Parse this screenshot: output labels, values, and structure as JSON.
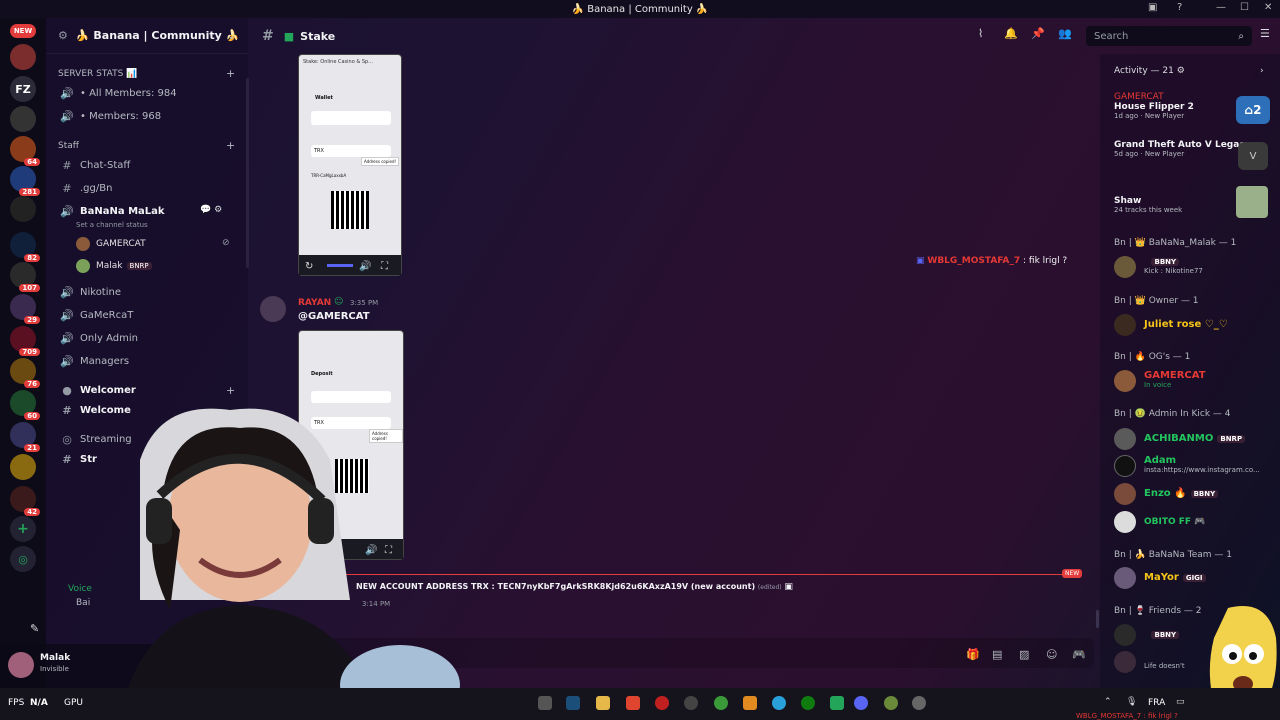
{
  "window": {
    "title": "🍌 Banana | Community 🍌"
  },
  "server": {
    "name": "🍌 Banana | Community 🍌"
  },
  "rail": {
    "new_badge": "NEW",
    "items": [
      {
        "label": "FZ"
      },
      {
        "label": "",
        "badge": "64"
      },
      {
        "label": "",
        "badge": "281"
      },
      {
        "label": "",
        "badge": "82"
      },
      {
        "label": "",
        "badge": "107"
      },
      {
        "label": "",
        "badge": "29"
      },
      {
        "label": "",
        "badge": "709"
      },
      {
        "label": "",
        "badge": "76"
      },
      {
        "label": "",
        "badge": "60"
      },
      {
        "label": "",
        "badge": "21"
      },
      {
        "label": "",
        "badge": "42"
      }
    ]
  },
  "sidebar": {
    "server_stats": "SERVER STATS 📊",
    "all_members": "• All Members: 984",
    "members": "• Members: 968",
    "staff_category": "Staff",
    "channels_staff": [
      {
        "name": "Chat-Staff",
        "icon": "#"
      },
      {
        "name": ".gg/Bn",
        "icon": "#"
      },
      {
        "name": "BaNaNa MaLak",
        "icon": "🔊"
      }
    ],
    "channel_status": "Set a channel status",
    "voice_users": [
      {
        "name": "GAMERCAT"
      },
      {
        "name": "Malak",
        "tag": "BNRP"
      }
    ],
    "channels_more": [
      {
        "name": "Nikotine"
      },
      {
        "name": "GaMeRcaT"
      },
      {
        "name": "Only Admin"
      },
      {
        "name": "Managers"
      }
    ],
    "welcomer_category": "Welcomer",
    "welcome_channel": "Welcome",
    "streaming_category": "Streaming",
    "str_channel": "Str",
    "voice_label": "Voice",
    "bai_label": "Bai"
  },
  "user": {
    "name": "Malak",
    "status": "Invisible"
  },
  "chat": {
    "channel": "Stake",
    "search_placeholder": "Search",
    "right_message": {
      "author": "WBLG_MOSTAFA_7",
      "text": ": fik lrigl ?"
    },
    "message": {
      "author": "RAYAN",
      "time": "3:35 PM",
      "mention": "@GAMERCAT"
    },
    "phone1": {
      "title": "Stake: Online Casino & Sp...",
      "wallet": "Wallet",
      "network": "TRX",
      "copied": "Address copied!",
      "address": "TRR-CaMgLaxxbA"
    },
    "phone2": {
      "deposit": "Deposit",
      "network": "TRX",
      "copied": "Address copied!"
    },
    "new_divider": "NEW",
    "bottom_message": "NEW ACCOUNT ADDRESS TRX : TECN7nyKbF7gArkSRK8Kjd62u6KAxzA19V  (new account)",
    "edited": "(edited)",
    "bottom_time": "3:14 PM"
  },
  "activity": {
    "header": "Activity — 21",
    "items": [
      {
        "user": "GAMERCAT",
        "game": "House Flipper 2",
        "meta": "1d ago  ·  New Player"
      },
      {
        "user": "",
        "game": "Grand Theft Auto V Legacy",
        "meta": "5d ago  ·  New Player"
      },
      {
        "user": "",
        "game": "Shaw",
        "meta": "24 tracks this week"
      }
    ]
  },
  "members": {
    "groups": [
      {
        "title": "Bn | 👑 BaNaNa_Malak — 1",
        "rows": [
          {
            "name": "",
            "tag": "BBNY",
            "sub": "Kick : Nikotine77",
            "color": "#3b82f6"
          }
        ]
      },
      {
        "title": "Bn | 👑 Owner — 1",
        "rows": [
          {
            "name": "Juliet rose ♡_♡",
            "sub": "",
            "color": "#f5c518"
          }
        ]
      },
      {
        "title": "Bn | 🔥 OG's — 1",
        "rows": [
          {
            "name": "GAMERCAT",
            "sub": "In voice",
            "color": "#e53935"
          }
        ]
      },
      {
        "title": "Bn | 🤢 Admin In Kick — 4",
        "rows": [
          {
            "name": "ACHIBANMO",
            "tag": "BNRP",
            "sub": "",
            "color": "#22c55e"
          },
          {
            "name": "Adam",
            "sub": "insta:https://www.instagram.co...",
            "color": "#22c55e"
          },
          {
            "name": "Enzo 🔥",
            "tag": "BBNY",
            "sub": "",
            "color": "#22c55e"
          },
          {
            "name": "OBITO FF 🎮",
            "sub": "",
            "color": "#22c55e"
          }
        ]
      },
      {
        "title": "Bn | 🍌 BaNaNa Team — 1",
        "rows": [
          {
            "name": "MaYor",
            "tag": "GIGI",
            "sub": "",
            "color": "#f5c518"
          }
        ]
      },
      {
        "title": "Bn | 🍷 Friends — 2",
        "rows": [
          {
            "name": "",
            "tag": "BBNY",
            "sub": "",
            "color": "#3b82f6"
          },
          {
            "name": "",
            "sub": "Life doesn't",
            "color": "#3b82f6"
          }
        ]
      }
    ]
  },
  "taskbar": {
    "fps": "FPS",
    "fps_val": "N/A",
    "gpu": "GPU",
    "lang": "FRA",
    "tray_text": "WBLG_MOSTAFA_7 : fik lrigl ?"
  },
  "colors": {
    "accent": "#5865f2",
    "red": "#e53935",
    "green": "#22c55e",
    "yellow": "#f5c518"
  }
}
